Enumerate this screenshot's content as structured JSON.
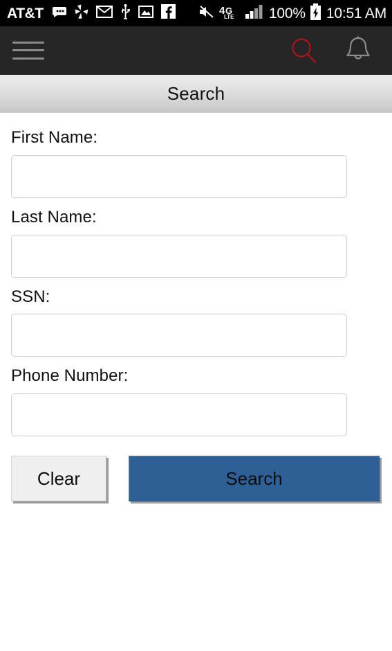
{
  "status_bar": {
    "carrier": "AT&T",
    "battery_percent": "100%",
    "clock": "10:51 AM",
    "network_type": "4G",
    "network_sub": "LTE",
    "signal_bars_filled": 2,
    "signal_bars_total": 4,
    "icons": [
      "message-bubble-icon",
      "yelp-burst-icon",
      "envelope-icon",
      "usb-icon",
      "photo-icon",
      "facebook-icon",
      "mute-speaker-icon",
      "lte-network-icon",
      "signal-bars-icon",
      "battery-charging-icon"
    ],
    "colors": {
      "background": "#000000",
      "foreground": "#ffffff"
    }
  },
  "toolbar": {
    "menu_icon": "hamburger-menu-icon",
    "search_icon": "search-magnifier-icon",
    "notification_icon": "bell-icon",
    "colors": {
      "background": "#262626",
      "icon": "#8c8c8c",
      "search_accent": "#b0121f"
    }
  },
  "title_bar": {
    "title": "Search"
  },
  "form": {
    "fields": [
      {
        "label": "First Name:",
        "value": "",
        "placeholder": ""
      },
      {
        "label": "Last Name:",
        "value": "",
        "placeholder": ""
      },
      {
        "label": "SSN:",
        "value": "",
        "placeholder": ""
      },
      {
        "label": "Phone Number:",
        "value": "",
        "placeholder": ""
      }
    ]
  },
  "buttons": {
    "clear_label": "Clear",
    "search_label": "Search",
    "colors": {
      "clear_background": "#efefef",
      "search_background": "#2e6096",
      "shadow": "#9a9a9a"
    }
  }
}
